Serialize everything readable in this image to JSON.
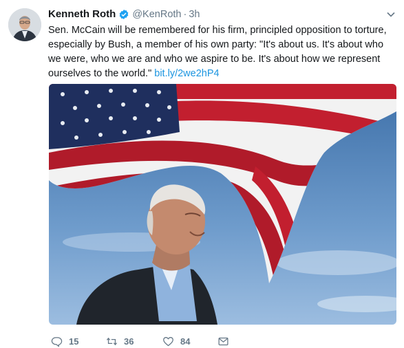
{
  "author": {
    "name": "Kenneth Roth",
    "handle": "@KenRoth",
    "separator": "·",
    "time": "3h"
  },
  "tweet": {
    "text": "Sen. McCain will be remembered for his firm, principled opposition to torture, especially by Bush, a member of his own party: \"It's about us. It's about who we were, who we are and who we aspire to be. It's about how we represent ourselves to the world.\" ",
    "link": "bit.ly/2we2hP4"
  },
  "actions": {
    "replies": "15",
    "retweets": "36",
    "likes": "84"
  },
  "icons": {
    "verified": "verified-badge-icon",
    "caret": "chevron-down-icon",
    "reply": "reply-icon",
    "retweet": "retweet-icon",
    "like": "heart-icon",
    "dm": "envelope-icon"
  },
  "colors": {
    "link": "#1b95e0",
    "secondary_text": "#657786",
    "verified": "#1da1f2"
  }
}
